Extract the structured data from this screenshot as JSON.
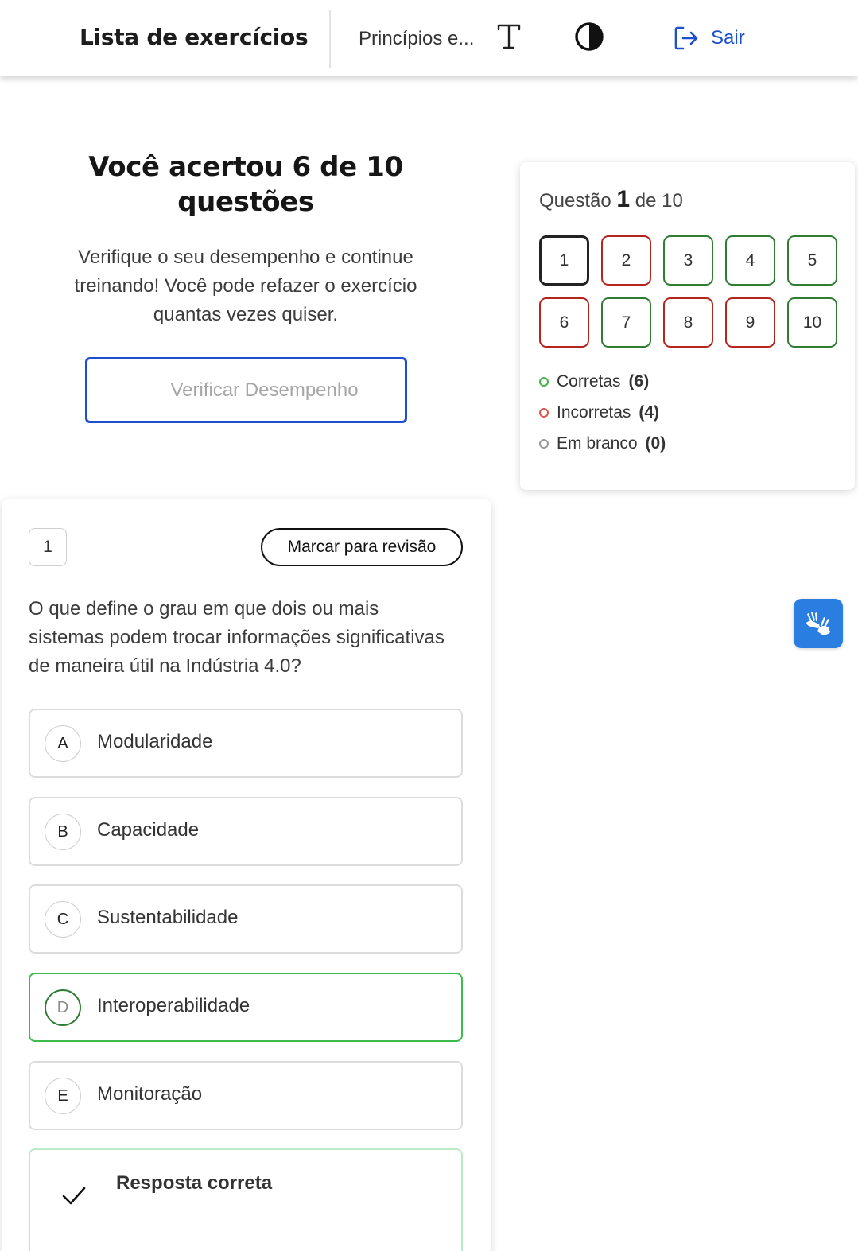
{
  "header": {
    "title": "Lista de exercícios",
    "subject": "Princípios e...",
    "logout_label": "Sair",
    "icons": [
      "text-size-icon",
      "contrast-icon",
      "logout-icon"
    ]
  },
  "result": {
    "heading": "Você acertou 6 de 10 questões",
    "description": "Verifique o seu desempenho e continue treinando! Você pode refazer o exercício quantas vezes quiser.",
    "verify_button": "Verificar Desempenho"
  },
  "navigator": {
    "prefix": "Questão",
    "current": "1",
    "suffix": "de 10",
    "questions": [
      {
        "label": "1",
        "status": "current"
      },
      {
        "label": "2",
        "status": "incorrect"
      },
      {
        "label": "3",
        "status": "correct"
      },
      {
        "label": "4",
        "status": "correct"
      },
      {
        "label": "5",
        "status": "correct"
      },
      {
        "label": "6",
        "status": "incorrect"
      },
      {
        "label": "7",
        "status": "correct"
      },
      {
        "label": "8",
        "status": "incorrect"
      },
      {
        "label": "9",
        "status": "incorrect"
      },
      {
        "label": "10",
        "status": "correct"
      }
    ],
    "legend": [
      {
        "label": "Corretas",
        "count": "(6)",
        "color": "#43b549"
      },
      {
        "label": "Incorretas",
        "count": "(4)",
        "color": "#e0564c"
      },
      {
        "label": "Em branco",
        "count": "(0)",
        "color": "#999999"
      }
    ]
  },
  "question": {
    "number": "1",
    "review_button": "Marcar para revisão",
    "text": "O que define o grau em que dois ou mais sistemas podem trocar informações significativas de maneira útil na Indústria 4.0?",
    "options": [
      {
        "letter": "A",
        "label": "Modularidade",
        "correct": false
      },
      {
        "letter": "B",
        "label": "Capacidade",
        "correct": false
      },
      {
        "letter": "C",
        "label": "Sustentabilidade",
        "correct": false
      },
      {
        "letter": "D",
        "label": "Interoperabilidade",
        "correct": true
      },
      {
        "letter": "E",
        "label": "Monitoração",
        "correct": false
      }
    ],
    "feedback_title": "Resposta correta"
  },
  "colors": {
    "accent": "#1d4fcf",
    "correct": "#2e7d32",
    "incorrect": "#b3261e",
    "a11y": "#2a7de1"
  }
}
